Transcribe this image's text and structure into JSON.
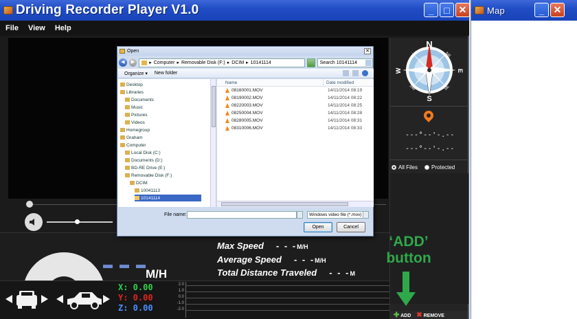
{
  "app": {
    "title": "Driving Recorder Player V1.0",
    "menu": [
      "File",
      "View",
      "Help"
    ],
    "location": {
      "line1": "---°--'-.--",
      "line2": "---°--'-.--"
    },
    "filters": [
      {
        "label": "All Files",
        "selected": true
      },
      {
        "label": "Protected",
        "selected": false
      }
    ],
    "speed": {
      "value": "- - -",
      "unit": "M/H"
    },
    "stats": [
      {
        "label": "Max Speed",
        "value": "- - -",
        "unit": "M/H"
      },
      {
        "label": "Average Speed",
        "value": "- - -",
        "unit": "M/H"
      },
      {
        "label": "Total Distance Traveled",
        "value": "- - -",
        "unit": "M"
      }
    ],
    "gsensor": {
      "x": "X: 0.00",
      "y": "Y: 0.00",
      "z": "Z: 0.00",
      "scale": [
        "2.0",
        "1.0",
        "0.0",
        "-1.0",
        "-2.0"
      ]
    },
    "buttons": {
      "add": "ADD",
      "remove": "REMOVE"
    },
    "compass": {
      "n": "N",
      "s": "S",
      "e": "E",
      "w": "W",
      "ne": "NE",
      "nw": "NW",
      "se": "SE",
      "sw": "SW"
    }
  },
  "annotation": {
    "line1": "‘ADD’",
    "line2": "button",
    "color": "#2fa84a"
  },
  "map_window": {
    "title": "Map"
  },
  "dialog": {
    "title": "Open",
    "path": [
      "Computer",
      "Removable Disk (F:)",
      "DCIM",
      "10141114"
    ],
    "search_placeholder": "Search 10141114",
    "toolbar": {
      "organize": "Organize ▾",
      "new_folder": "New folder"
    },
    "tree": [
      {
        "label": "Desktop",
        "indent": 0
      },
      {
        "label": "Libraries",
        "indent": 0
      },
      {
        "label": "Documents",
        "indent": 1
      },
      {
        "label": "Music",
        "indent": 1
      },
      {
        "label": "Pictures",
        "indent": 1
      },
      {
        "label": "Videos",
        "indent": 1
      },
      {
        "label": "Homegroup",
        "indent": 0
      },
      {
        "label": "Graham",
        "indent": 0
      },
      {
        "label": "Computer",
        "indent": 0
      },
      {
        "label": "Local Disk (C:)",
        "indent": 1
      },
      {
        "label": "Documents (D:)",
        "indent": 1
      },
      {
        "label": "BD-RE Drive (E:)",
        "indent": 1
      },
      {
        "label": "Removable Disk (F:)",
        "indent": 1
      },
      {
        "label": "DCIM",
        "indent": 2
      },
      {
        "label": "10041113",
        "indent": 3
      },
      {
        "label": "10141114",
        "indent": 3,
        "selected": true
      }
    ],
    "columns": {
      "name": "Name",
      "date": "Date modified"
    },
    "files": [
      {
        "name": "08160001.MOV",
        "date": "14/11/2014 08:19"
      },
      {
        "name": "08190002.MOV",
        "date": "14/11/2014 08:22"
      },
      {
        "name": "08220003.MOV",
        "date": "14/11/2014 08:25"
      },
      {
        "name": "08250004.MOV",
        "date": "14/11/2014 08:28"
      },
      {
        "name": "08280005.MOV",
        "date": "14/11/2014 08:31"
      },
      {
        "name": "08310006.MOV",
        "date": "14/11/2014 08:33"
      }
    ],
    "file_name_label": "File name:",
    "file_name_value": "",
    "file_type": "Windows video file (*.mov)",
    "open_label": "Open",
    "cancel_label": "Cancel"
  }
}
